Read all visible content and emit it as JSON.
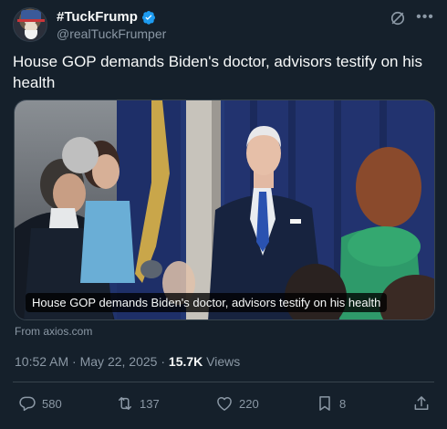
{
  "header": {
    "display_name": "#TuckFrump",
    "handle": "@realTuckFrumper",
    "avatar": "avatar-uncle-sam-caricature",
    "verified_color": "#1d9bf0"
  },
  "tweet": {
    "text": "House GOP demands Biden's doctor, advisors testify on his health"
  },
  "media": {
    "caption": "House GOP demands Biden's doctor, advisors testify on his health",
    "source": "From axios.com"
  },
  "meta": {
    "time": "10:52 AM",
    "separator": "·",
    "date": "May 22, 2025",
    "separator2": "·",
    "views_count": "15.7K",
    "views_label": "Views"
  },
  "actions": {
    "replies": "580",
    "reposts": "137",
    "likes": "220",
    "bookmarks": "8"
  },
  "icons": {
    "grok": "grok-icon",
    "more": "more-icon",
    "reply": "reply-icon",
    "repost": "repost-icon",
    "like": "heart-icon",
    "bookmark": "bookmark-icon",
    "share": "share-icon"
  },
  "colors": {
    "background": "#15202b",
    "text": "#f7f9f9",
    "muted": "#8b98a5",
    "accent": "#1d9bf0"
  }
}
